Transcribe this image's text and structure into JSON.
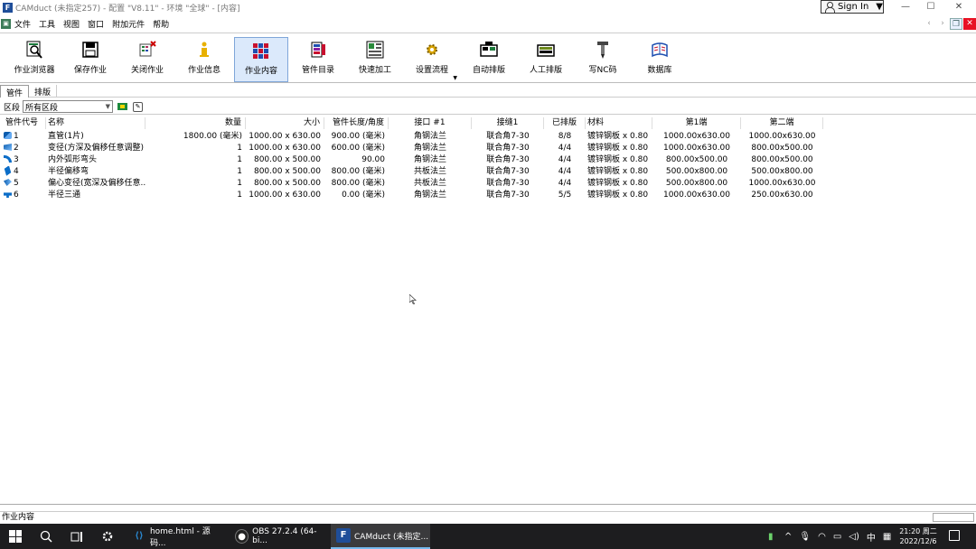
{
  "window": {
    "title": "CAMduct (未指定257) - 配置 \"V8.11\" - 环境 \"全球\" - [内容]",
    "signin_label": "Sign In",
    "minimize": "—",
    "maximize": "☐",
    "close": "✕"
  },
  "menubar": {
    "items": [
      "文件",
      "工具",
      "视图",
      "窗口",
      "附加元件",
      "帮助"
    ]
  },
  "toolbar": {
    "buttons": [
      {
        "label": "作业浏览器",
        "icon": "job-browser-icon"
      },
      {
        "label": "保存作业",
        "icon": "save-job-icon"
      },
      {
        "label": "关闭作业",
        "icon": "close-job-icon"
      },
      {
        "label": "作业信息",
        "icon": "job-info-icon"
      },
      {
        "label": "作业内容",
        "icon": "job-contents-icon",
        "active": true
      },
      {
        "label": "管件目录",
        "icon": "fitting-catalog-icon"
      },
      {
        "label": "快速加工",
        "icon": "quick-process-icon"
      },
      {
        "label": "设置流程",
        "icon": "setup-process-icon"
      },
      {
        "label": "自动排版",
        "icon": "auto-nest-icon"
      },
      {
        "label": "人工排版",
        "icon": "manual-nest-icon"
      },
      {
        "label": "写NC码",
        "icon": "write-nc-icon"
      },
      {
        "label": "数据库",
        "icon": "database-icon"
      }
    ]
  },
  "tabs": [
    {
      "label": "管件",
      "selected": true
    },
    {
      "label": "排版",
      "selected": false
    }
  ],
  "zone": {
    "label": "区段",
    "value": "所有区段"
  },
  "table": {
    "columns": [
      "管件代号",
      "名称",
      "数量",
      "大小",
      "管件长度/角度",
      "接口 #1",
      "接缝1",
      "已排版",
      "材料",
      "第1端",
      "第二端"
    ],
    "rows": [
      {
        "icon": "duct",
        "code": "1",
        "name": "直管(1片)",
        "qty": "1800.00 (毫米)",
        "size": "1000.00 x 630.00",
        "length": "900.00 (毫米)",
        "connector": "角钢法兰",
        "seam": "联合角7-30",
        "nested": "8/8",
        "material": "镀锌钢板 x 0.80",
        "end1": "1000.00x630.00",
        "end2": "1000.00x630.00"
      },
      {
        "icon": "reducer",
        "code": "2",
        "name": "变径(方深及偏移任意调整)",
        "qty": "1",
        "size": "1000.00 x 630.00",
        "length": "600.00 (毫米)",
        "connector": "角钢法兰",
        "seam": "联合角7-30",
        "nested": "4/4",
        "material": "镀锌钢板 x 0.80",
        "end1": "1000.00x630.00",
        "end2": "800.00x500.00"
      },
      {
        "icon": "elbow",
        "code": "3",
        "name": "内外弧形弯头",
        "qty": "1",
        "size": "800.00 x 500.00",
        "length": "90.00",
        "connector": "角钢法兰",
        "seam": "联合角7-30",
        "nested": "4/4",
        "material": "镀锌钢板 x 0.80",
        "end1": "800.00x500.00",
        "end2": "800.00x500.00"
      },
      {
        "icon": "bend",
        "code": "4",
        "name": "半径偏移弯",
        "qty": "1",
        "size": "800.00 x 500.00",
        "length": "800.00 (毫米)",
        "connector": "共板法兰",
        "seam": "联合角7-30",
        "nested": "4/4",
        "material": "镀锌钢板 x 0.80",
        "end1": "500.00x800.00",
        "end2": "500.00x800.00"
      },
      {
        "icon": "offset",
        "code": "5",
        "name": "偏心变径(宽深及偏移任意...",
        "qty": "1",
        "size": "800.00 x 500.00",
        "length": "800.00 (毫米)",
        "connector": "共板法兰",
        "seam": "联合角7-30",
        "nested": "4/4",
        "material": "镀锌钢板 x 0.80",
        "end1": "500.00x800.00",
        "end2": "1000.00x630.00"
      },
      {
        "icon": "tee",
        "code": "6",
        "name": "半径三通",
        "qty": "1",
        "size": "1000.00 x 630.00",
        "length": "0.00 (毫米)",
        "connector": "角钢法兰",
        "seam": "联合角7-30",
        "nested": "5/5",
        "material": "镀锌钢板 x 0.80",
        "end1": "1000.00x630.00",
        "end2": "250.00x630.00"
      }
    ]
  },
  "status": {
    "text": "作业内容"
  },
  "taskbar": {
    "apps": [
      {
        "label": "home.html - 源码...",
        "icon": "vscode-icon",
        "color": "#2a8ad4"
      },
      {
        "label": "OBS 27.2.4 (64-bi...",
        "icon": "obs-icon",
        "color": "#222222"
      },
      {
        "label": "CAMduct (未指定...",
        "icon": "camduct-icon",
        "color": "#1f4e99",
        "active": true
      }
    ],
    "ime": "中",
    "time": "21:20 周二",
    "date": "2022/12/6"
  }
}
